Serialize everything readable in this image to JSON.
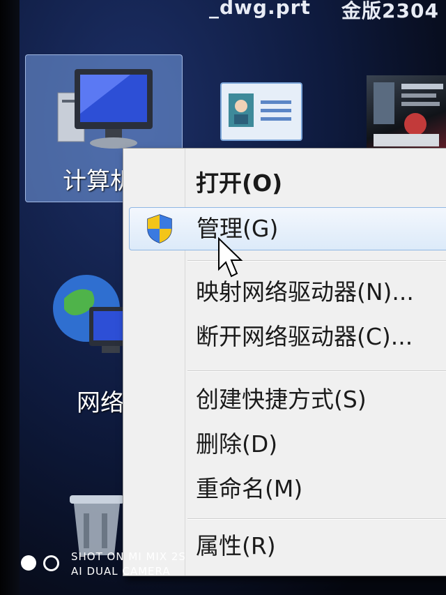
{
  "top_filenames": [
    "_dwg.prt",
    "金版2304"
  ],
  "desktop_icons": {
    "computer_label": "计算机",
    "network_label": "网络"
  },
  "context_menu": {
    "items": [
      {
        "label": "打开(O)",
        "bold": true
      },
      {
        "label": "管理(G)",
        "hover": true,
        "icon": "uac-shield-icon"
      },
      {
        "label": "映射网络驱动器(N)..."
      },
      {
        "label": "断开网络驱动器(C)..."
      },
      {
        "label": "创建快捷方式(S)"
      },
      {
        "label": "删除(D)"
      },
      {
        "label": "重命名(M)"
      },
      {
        "label": "属性(R)"
      }
    ]
  },
  "watermark": {
    "line1": "SHOT ON MI MIX 2S",
    "line2": "AI DUAL CAMERA"
  }
}
